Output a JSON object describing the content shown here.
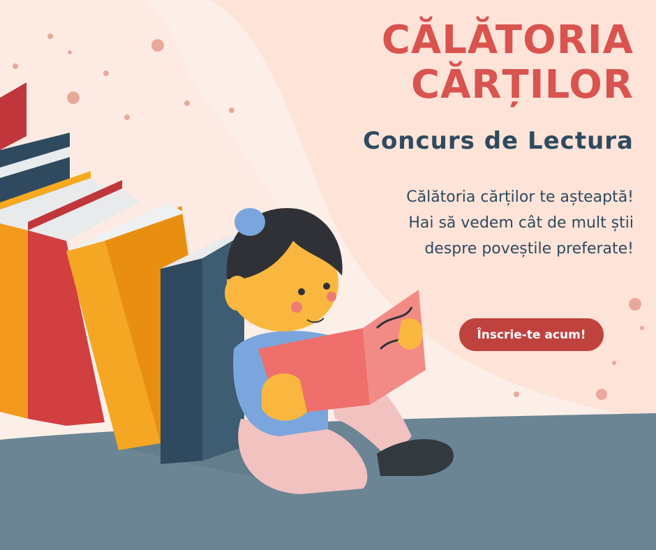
{
  "poster": {
    "title_line1": "CĂLĂTORIA",
    "title_line2": "CĂRȚILOR",
    "subtitle": "Concurs de Lectura",
    "description": "Călătoria cărților te așteaptă! Hai să vedem cât de mult știi despre poveștile preferate!",
    "cta_label": "Înscrie-te acum!"
  },
  "colors": {
    "background": "#fde3d8",
    "floor": "#6b8594",
    "title": "#d9534f",
    "subtitle": "#2f4a5e",
    "button": "#c0423f"
  },
  "illustration": {
    "subject": "girl-reading-book-icon",
    "books": "book-stack-icon"
  }
}
